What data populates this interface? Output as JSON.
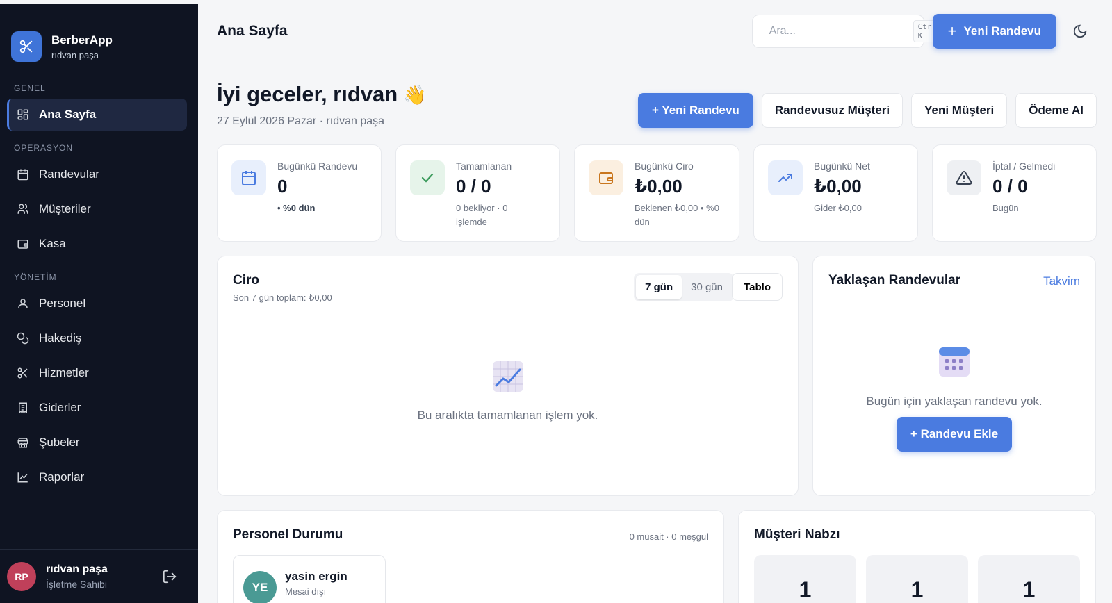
{
  "brand": {
    "name": "BerberApp",
    "sub": "rıdvan paşa"
  },
  "sidebar": {
    "sections": {
      "genel": "GENEL",
      "operasyon": "OPERASYON",
      "yonetim": "YÖNETİM"
    },
    "items": [
      {
        "label": "Ana Sayfa",
        "icon": "grid-icon"
      },
      {
        "label": "Randevular",
        "icon": "calendar-icon"
      },
      {
        "label": "Müşteriler",
        "icon": "users-icon"
      },
      {
        "label": "Kasa",
        "icon": "wallet-icon"
      },
      {
        "label": "Personel",
        "icon": "user-icon"
      },
      {
        "label": "Hakediş",
        "icon": "coins-icon"
      },
      {
        "label": "Hizmetler",
        "icon": "scissors-icon"
      },
      {
        "label": "Giderler",
        "icon": "receipt-icon"
      },
      {
        "label": "Şubeler",
        "icon": "store-icon"
      },
      {
        "label": "Raporlar",
        "icon": "chart-line-icon"
      }
    ],
    "footer": {
      "initials": "RP",
      "name": "rıdvan paşa",
      "role": "İşletme Sahibi"
    }
  },
  "topbar": {
    "title": "Ana Sayfa",
    "search_placeholder": "Ara...",
    "search_shortcut": "Ctrl K",
    "new_appointment": "Yeni Randevu"
  },
  "greeting": {
    "title": "İyi geceler, rıdvan",
    "emoji": "👋",
    "subtitle": "27 Eylül 2026 Pazar · rıdvan paşa"
  },
  "actions": {
    "new_appointment": "+ Yeni Randevu",
    "walk_in": "Randevusuz Müşteri",
    "new_customer": "Yeni Müşteri",
    "take_payment": "Ödeme Al"
  },
  "stats": [
    {
      "label": "Bugünkü Randevu",
      "value": "0",
      "sub": "• %0 dün"
    },
    {
      "label": "Tamamlanan",
      "value": "0 / 0",
      "sub": "0 bekliyor · 0 işlemde"
    },
    {
      "label": "Bugünkü Ciro",
      "value": "₺0,00",
      "sub": "Beklenen ₺0,00 • %0 dün"
    },
    {
      "label": "Bugünkü Net",
      "value": "₺0,00",
      "sub": "Gider ₺0,00"
    },
    {
      "label": "İptal / Gelmedi",
      "value": "0 / 0",
      "sub": "Bugün"
    }
  ],
  "ciro": {
    "title": "Ciro",
    "subtitle": "Son 7 gün toplam: ₺0,00",
    "range_7": "7 gün",
    "range_30": "30 gün",
    "table_button": "Tablo",
    "empty_emoji": "📈",
    "empty_text": "Bu aralıkta tamamlanan işlem yok."
  },
  "upcoming": {
    "title": "Yaklaşan Randevular",
    "calendar_link": "Takvim",
    "empty_text": "Bugün için yaklaşan randevu yok.",
    "add_button": "+ Randevu Ekle"
  },
  "staff": {
    "title": "Personel Durumu",
    "meta": "0 müsait · 0 meşgul",
    "members": [
      {
        "initials": "YE",
        "name": "yasin ergin",
        "status": "Mesai dışı"
      }
    ]
  },
  "pulse": {
    "title": "Müşteri Nabzı",
    "values": [
      "1",
      "1",
      "1"
    ]
  },
  "colors": {
    "accent": "#4a7be0",
    "sidebar_bg": "#0f1422",
    "page_bg": "#f5f6f8"
  }
}
